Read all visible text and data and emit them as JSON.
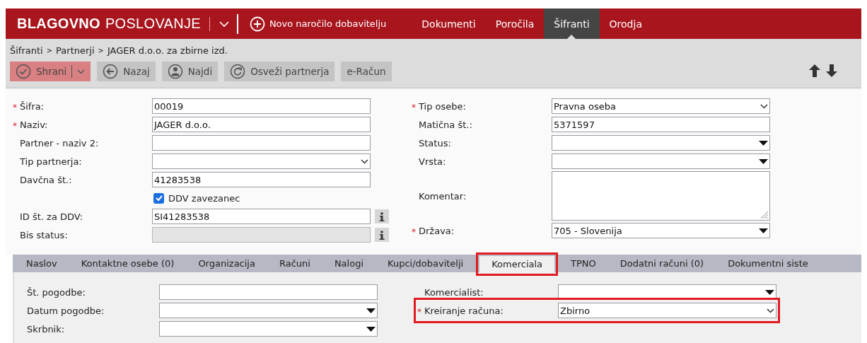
{
  "header": {
    "brand_bold": "BLAGOVNO",
    "brand_light": "POSLOVANJE",
    "new_order": "Novo naročilo dobavitelju",
    "menu": [
      {
        "label": "Dokumenti",
        "selected": false
      },
      {
        "label": "Poročila",
        "selected": false
      },
      {
        "label": "Šifranti",
        "selected": true
      },
      {
        "label": "Orodja",
        "selected": false
      }
    ]
  },
  "breadcrumb": {
    "separator": ">",
    "items": [
      "Šifranti",
      "Partnerji",
      "JAGER d.o.o. za zbirne izd."
    ]
  },
  "toolbar": [
    {
      "label": "Shrani",
      "kind": "save"
    },
    {
      "label": "Nazaj",
      "kind": "back"
    },
    {
      "label": "Najdi",
      "kind": "find"
    },
    {
      "label": "Osveži partnerja",
      "kind": "refresh"
    },
    {
      "label": "e-Račun",
      "kind": "plain"
    }
  ],
  "required_mark": "*",
  "form": {
    "left": [
      {
        "kind": "text",
        "label": "Šifra:",
        "required": true,
        "value": "00019",
        "disabled": false,
        "info": false
      },
      {
        "kind": "text",
        "label": "Naziv:",
        "required": true,
        "value": "JAGER d.o.o.",
        "disabled": false,
        "info": false
      },
      {
        "kind": "text",
        "label": "Partner - naziv 2:",
        "required": false,
        "disabled": false,
        "info": false
      },
      {
        "kind": "select",
        "label": "Tip partnerja:",
        "required": false,
        "disabled": false,
        "info": false
      },
      {
        "kind": "text",
        "label": "Davčna št.:",
        "required": false,
        "value": "41283538",
        "disabled": false,
        "info": false
      },
      {
        "kind": "checkbox",
        "label": "DDV zavezanec",
        "checked": true
      },
      {
        "kind": "text",
        "label": "ID št. za DDV:",
        "required": false,
        "value": "SI41283538",
        "disabled": false,
        "info": true
      },
      {
        "kind": "text",
        "label": "Bis status:",
        "required": false,
        "disabled": true,
        "info": true
      }
    ],
    "right": [
      {
        "kind": "select",
        "label": "Tip osebe:",
        "required": true,
        "value": "Pravna oseba",
        "disabled": false,
        "info": false
      },
      {
        "kind": "text",
        "label": "Matična št.:",
        "required": false,
        "value": "5371597",
        "disabled": false,
        "info": false
      },
      {
        "kind": "dropdown",
        "label": "Status:",
        "required": false,
        "disabled": false,
        "info": false
      },
      {
        "kind": "dropdown",
        "label": "Vrsta:",
        "required": false,
        "disabled": false,
        "info": false
      },
      {
        "kind": "textarea",
        "label": "Komentar:",
        "required": false,
        "disabled": false,
        "info": false
      },
      {
        "kind": "dropdown",
        "label": "Država:",
        "required": true,
        "value": "705 - Slovenija",
        "disabled": false,
        "info": false
      }
    ]
  },
  "tabs": [
    {
      "label": "Naslov",
      "selected": false,
      "highlighted": false
    },
    {
      "label": "Kontaktne osebe (0)",
      "selected": false,
      "highlighted": false
    },
    {
      "label": "Organizacija",
      "selected": false,
      "highlighted": false
    },
    {
      "label": "Računi",
      "selected": false,
      "highlighted": false
    },
    {
      "label": "Nalogi",
      "selected": false,
      "highlighted": false
    },
    {
      "label": "Kupci/dobavitelji",
      "selected": false,
      "highlighted": false
    },
    {
      "label": "Komerciala",
      "selected": true,
      "highlighted": true
    },
    {
      "label": "TPNO",
      "selected": false,
      "highlighted": false
    },
    {
      "label": "Dodatni računi (0)",
      "selected": false,
      "highlighted": false
    },
    {
      "label": "Dokumentni siste",
      "selected": false,
      "highlighted": false
    }
  ],
  "panel": {
    "left": [
      {
        "kind": "text",
        "label": "Št. pogodbe:",
        "required": false,
        "disabled": false,
        "info": false,
        "highlighted": false
      },
      {
        "kind": "dropdown",
        "label": "Datum pogodbe:",
        "required": false,
        "disabled": false,
        "info": false,
        "highlighted": false
      },
      {
        "kind": "dropdown",
        "label": "Skrbnik:",
        "required": false,
        "disabled": false,
        "info": false,
        "highlighted": false
      }
    ],
    "right": [
      {
        "kind": "dropdown",
        "label": "Komercialist:",
        "required": false,
        "disabled": false,
        "info": false,
        "highlighted": false
      },
      {
        "kind": "select",
        "label": "Kreiranje računa:",
        "required": true,
        "value": "Zbirno",
        "disabled": false,
        "info": false,
        "highlighted": true
      }
    ]
  }
}
